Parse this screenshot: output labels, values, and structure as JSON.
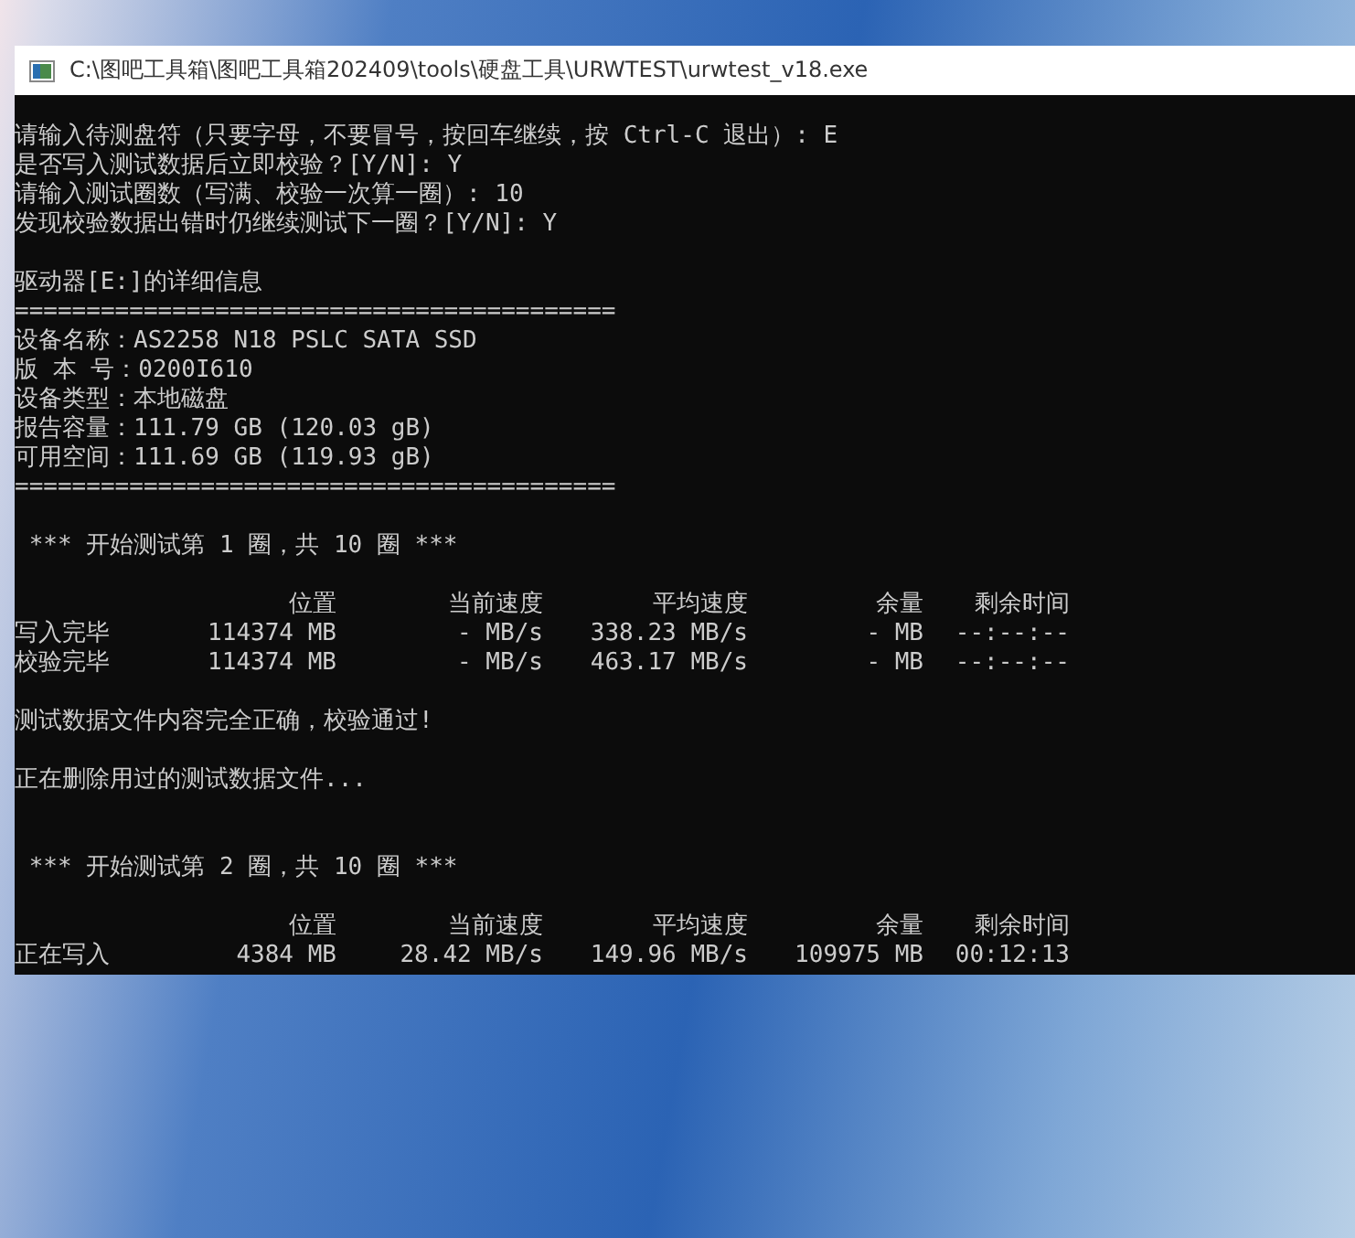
{
  "window": {
    "title": "C:\\图吧工具箱\\图吧工具箱202409\\tools\\硬盘工具\\URWTEST\\urwtest_v18.exe"
  },
  "console": {
    "lines": [
      {
        "kind": "text",
        "text": "请输入待测盘符（只要字母，不要冒号，按回车继续，按 Ctrl-C 退出）: E"
      },
      {
        "kind": "text",
        "text": "是否写入测试数据后立即校验？[Y/N]: Y"
      },
      {
        "kind": "text",
        "text": "请输入测试圈数（写满、校验一次算一圈）: 10"
      },
      {
        "kind": "text",
        "text": "发现校验数据出错时仍继续测试下一圈？[Y/N]: Y"
      },
      {
        "kind": "blank"
      },
      {
        "kind": "text",
        "text": "驱动器[E:]的详细信息"
      },
      {
        "kind": "text",
        "text": "=========================================="
      },
      {
        "kind": "text",
        "text": "设备名称：AS2258 N18 PSLC SATA SSD"
      },
      {
        "kind": "text",
        "text": "版 本 号：0200I610"
      },
      {
        "kind": "text",
        "text": "设备类型：本地磁盘"
      },
      {
        "kind": "text",
        "text": "报告容量：111.79 GB (120.03 gB)"
      },
      {
        "kind": "text",
        "text": "可用空间：111.69 GB (119.93 gB)"
      },
      {
        "kind": "text",
        "text": "=========================================="
      },
      {
        "kind": "blank"
      },
      {
        "kind": "text",
        "text": " *** 开始测试第 1 圈，共 10 圈 ***"
      },
      {
        "kind": "blank"
      },
      {
        "kind": "table",
        "columns": [
          "",
          "位置",
          "当前速度",
          "平均速度",
          "余量",
          "剩余时间"
        ],
        "rows": [
          [
            "写入完毕",
            "114374 MB",
            "- MB/s",
            "338.23 MB/s",
            "- MB",
            "--:--:--"
          ],
          [
            "校验完毕",
            "114374 MB",
            "- MB/s",
            "463.17 MB/s",
            "- MB",
            "--:--:--"
          ]
        ]
      },
      {
        "kind": "blank"
      },
      {
        "kind": "text",
        "text": "测试数据文件内容完全正确，校验通过!"
      },
      {
        "kind": "blank"
      },
      {
        "kind": "text",
        "text": "正在删除用过的测试数据文件..."
      },
      {
        "kind": "blank"
      },
      {
        "kind": "blank"
      },
      {
        "kind": "text",
        "text": " *** 开始测试第 2 圈，共 10 圈 ***"
      },
      {
        "kind": "blank"
      },
      {
        "kind": "table",
        "columns": [
          "",
          "位置",
          "当前速度",
          "平均速度",
          "余量",
          "剩余时间"
        ],
        "rows": [
          [
            "正在写入",
            "4384 MB",
            "28.42 MB/s",
            "149.96 MB/s",
            "109975 MB",
            "00:12:13"
          ]
        ]
      }
    ]
  }
}
